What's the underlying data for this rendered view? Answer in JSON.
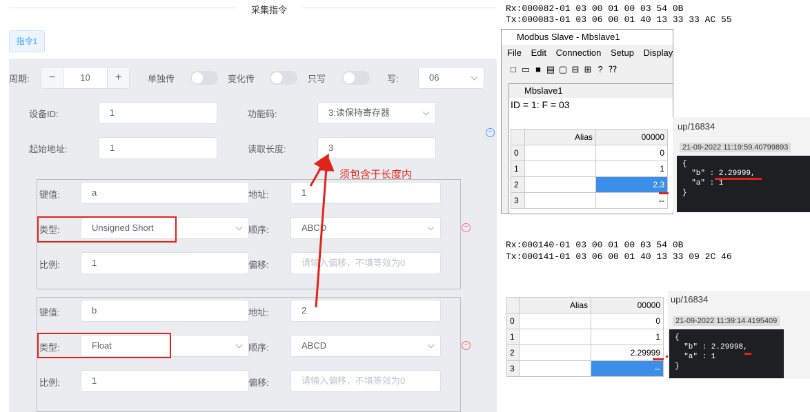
{
  "header": {
    "title": "采集指令"
  },
  "tabs": [
    {
      "label": "指令1"
    }
  ],
  "row1": {
    "period_label": "周期:",
    "period_value": "10",
    "minus": "−",
    "plus": "+",
    "single_label": "单独传",
    "change_label": "变化传",
    "writeonly_label": "只写",
    "write_label": "写:",
    "write_value": "06"
  },
  "device": {
    "id_label": "设备ID:",
    "id_value": "1",
    "func_label": "功能码:",
    "func_value": "3:读保持寄存器",
    "start_label": "起始地址:",
    "start_value": "1",
    "len_label": "读取长度:",
    "len_value": "3"
  },
  "annotation": {
    "note": "须包含于长度内"
  },
  "items": [
    {
      "key_label": "键值:",
      "key": "a",
      "addr_label": "地址:",
      "addr": "1",
      "type_label": "类型:",
      "type": "Unsigned Short",
      "order_label": "顺序:",
      "order": "ABCD",
      "scale_label": "比例:",
      "scale": "1",
      "offset_label": "偏移:",
      "offset_placeholder": "请输入偏移，不填等效为0"
    },
    {
      "key_label": "键值:",
      "key": "b",
      "addr_label": "地址:",
      "addr": "2",
      "type_label": "类型:",
      "type": "Float",
      "order_label": "顺序:",
      "order": "ABCD",
      "scale_label": "比例:",
      "scale": "1",
      "offset_label": "偏移:",
      "offset_placeholder": "请输入偏移，不填等效为0"
    }
  ],
  "serial": {
    "top_rx": "Rx:000082-01 03 00 01 00 03 54 0B",
    "top_tx": "Tx:000083-01 03 06 00 01 40 13 33 33 AC 55",
    "bottom_rx": "Rx:000140-01 03 00 01 00 03 54 0B",
    "bottom_tx": "Tx:000141-01 03 06 00 01 40 13 33 09 2C 46"
  },
  "modbus": {
    "title": "Modbus Slave - Mbslave1",
    "menu": [
      "File",
      "Edit",
      "Connection",
      "Setup",
      "Display"
    ],
    "child_title": "Mbslave1",
    "id_line": "ID = 1: F = 03",
    "col_alias": "Alias",
    "col_addr": "00000",
    "rows_top": [
      {
        "i": "0",
        "v": "0"
      },
      {
        "i": "1",
        "v": "1"
      },
      {
        "i": "2",
        "v": "2.3"
      },
      {
        "i": "3",
        "v": "--"
      }
    ],
    "rows_bottom": [
      {
        "i": "0",
        "v": "0"
      },
      {
        "i": "1",
        "v": "1"
      },
      {
        "i": "2",
        "v": "2.29999"
      },
      {
        "i": "3",
        "v": "--"
      }
    ]
  },
  "mqtt": {
    "top_topic": "up/16834",
    "top_time": "21-09-2022 11:19:59.40799893",
    "top_json_open": "{",
    "top_b": "  \"b\" : 2.29999,",
    "top_a": "  \"a\" : 1",
    "top_json_close": "}",
    "bottom_topic": "up/16834",
    "bottom_time": "21-09-2022 11:39:14.4195409",
    "bottom_json_open": "{",
    "bottom_b": "  \"b\" : 2.29998,",
    "bottom_a": "  \"a\" : 1",
    "bottom_json_close": "}"
  },
  "colors": {
    "accent": "#409eff",
    "annotation": "#e2231a",
    "selection": "#3b8fe8"
  }
}
